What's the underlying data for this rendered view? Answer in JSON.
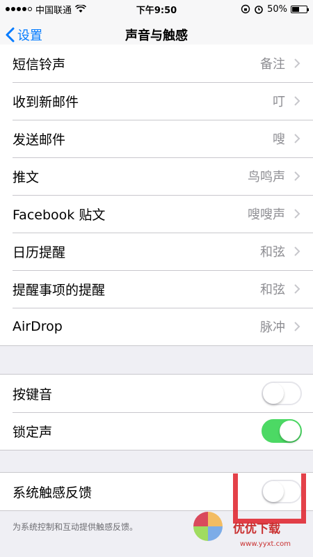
{
  "status_bar": {
    "carrier": "中国联通",
    "time": "下午9:50",
    "battery": "50%"
  },
  "nav": {
    "back_label": "设置",
    "title": "声音与触感"
  },
  "sound_rows": [
    {
      "label": "短信铃声",
      "value": "备注"
    },
    {
      "label": "收到新邮件",
      "value": "叮"
    },
    {
      "label": "发送邮件",
      "value": "嗖"
    },
    {
      "label": "推文",
      "value": "鸟鸣声"
    },
    {
      "label": "Facebook 贴文",
      "value": "嗖嗖声"
    },
    {
      "label": "日历提醒",
      "value": "和弦"
    },
    {
      "label": "提醒事项的提醒",
      "value": "和弦"
    },
    {
      "label": "AirDrop",
      "value": "脉冲"
    }
  ],
  "toggle_rows": [
    {
      "label": "按键音",
      "on": false
    },
    {
      "label": "锁定声",
      "on": true
    }
  ],
  "haptic_row": {
    "label": "系统触感反馈",
    "on": false
  },
  "footer": "为系统控制和互动提供触感反馈。",
  "watermark": {
    "text": "优优下载",
    "url": "www.yyxt.com"
  },
  "colors": {
    "accent": "#007aff",
    "toggle_on": "#4cd964",
    "value_gray": "#8e8e93"
  }
}
